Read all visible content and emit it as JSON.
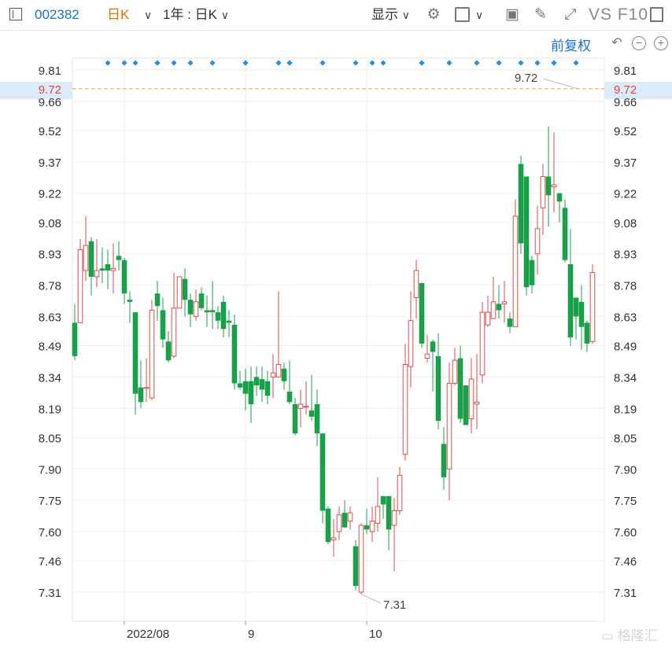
{
  "toolbar": {
    "ticker": "002382",
    "period": "日K",
    "range": "1年 : 日K",
    "display": "显示",
    "vs_f10": "VS F10",
    "icons": [
      "sidebar-toggle-icon",
      "chevron-down-icon",
      "gear-icon",
      "square-icon",
      "camera-icon",
      "pencil-icon",
      "fullscreen-icon"
    ]
  },
  "chart_controls": {
    "adjust": "前复权",
    "icons": [
      "undo-icon",
      "zoom-out-icon",
      "zoom-in-icon"
    ]
  },
  "watermark": "格隆汇",
  "colors": {
    "up": "#e04b4b",
    "down": "#18a148",
    "current": "#e8443a",
    "dashed": "#e0a050",
    "marker": "#1a8fe8",
    "link": "#1a73c8"
  },
  "chart_data": {
    "type": "candlestick",
    "y_ticks": [
      "9.81",
      "9.72",
      "9.66",
      "9.52",
      "9.37",
      "9.22",
      "9.08",
      "8.93",
      "8.78",
      "8.63",
      "8.49",
      "8.34",
      "8.19",
      "8.05",
      "7.90",
      "7.75",
      "7.60",
      "7.46",
      "7.31"
    ],
    "ylim": [
      7.22,
      9.87
    ],
    "current_price": "9.72",
    "max_label": "9.72",
    "min_label": "7.31",
    "x_labels": [
      {
        "label": "2022/08",
        "index": 9
      },
      {
        "label": "9",
        "index": 31
      },
      {
        "label": "10",
        "index": 53
      }
    ],
    "marker_indices": [
      6,
      9,
      11,
      15,
      18,
      21,
      25,
      31,
      37,
      39,
      45,
      51,
      54,
      56,
      63,
      68,
      73,
      77,
      81,
      84,
      87,
      91
    ],
    "candles": [
      [
        8.6,
        8.44,
        8.69,
        8.42
      ],
      [
        8.6,
        8.95,
        9.0,
        8.6
      ],
      [
        8.85,
        8.97,
        9.11,
        8.8
      ],
      [
        8.99,
        8.82,
        9.01,
        8.73
      ],
      [
        8.82,
        8.85,
        9.0,
        8.77
      ],
      [
        8.86,
        8.85,
        8.96,
        8.79
      ],
      [
        8.88,
        8.85,
        8.95,
        8.76
      ],
      [
        8.85,
        8.86,
        8.98,
        8.74
      ],
      [
        8.92,
        8.9,
        8.99,
        8.85
      ],
      [
        8.9,
        8.74,
        8.91,
        8.69
      ],
      [
        8.71,
        8.7,
        8.75,
        8.6
      ],
      [
        8.65,
        8.26,
        8.65,
        8.16
      ],
      [
        8.29,
        8.22,
        8.42,
        8.19
      ],
      [
        8.29,
        8.29,
        8.43,
        8.22
      ],
      [
        8.24,
        8.66,
        8.71,
        8.23
      ],
      [
        8.74,
        8.68,
        8.8,
        8.61
      ],
      [
        8.66,
        8.52,
        8.72,
        8.48
      ],
      [
        8.51,
        8.42,
        8.56,
        8.41
      ],
      [
        8.44,
        8.67,
        8.84,
        8.43
      ],
      [
        8.67,
        8.82,
        8.81,
        8.67
      ],
      [
        8.81,
        8.71,
        8.86,
        8.63
      ],
      [
        8.71,
        8.64,
        8.74,
        8.58
      ],
      [
        8.63,
        8.7,
        8.76,
        8.61
      ],
      [
        8.74,
        8.67,
        8.77,
        8.66
      ],
      [
        8.66,
        8.65,
        8.73,
        8.58
      ],
      [
        8.66,
        8.65,
        8.8,
        8.57
      ],
      [
        8.65,
        8.61,
        8.68,
        8.57
      ],
      [
        8.7,
        8.57,
        8.73,
        8.53
      ],
      [
        8.61,
        8.6,
        8.66,
        8.53
      ],
      [
        8.59,
        8.31,
        8.64,
        8.28
      ],
      [
        8.31,
        8.29,
        8.37,
        8.28
      ],
      [
        8.32,
        8.26,
        8.38,
        8.18
      ],
      [
        8.32,
        8.21,
        8.39,
        8.12
      ],
      [
        8.34,
        8.3,
        8.39,
        8.25
      ],
      [
        8.33,
        8.28,
        8.39,
        8.22
      ],
      [
        8.32,
        8.25,
        8.37,
        8.21
      ],
      [
        8.34,
        8.36,
        8.45,
        8.24
      ],
      [
        8.34,
        8.4,
        8.75,
        8.34
      ],
      [
        8.38,
        8.32,
        8.41,
        8.28
      ],
      [
        8.27,
        8.22,
        8.42,
        8.21
      ],
      [
        8.21,
        8.07,
        8.24,
        8.06
      ],
      [
        8.19,
        8.21,
        8.28,
        8.1
      ],
      [
        8.2,
        8.2,
        8.32,
        8.16
      ],
      [
        8.18,
        8.15,
        8.35,
        8.13
      ],
      [
        8.21,
        8.07,
        8.28,
        8.01
      ],
      [
        8.07,
        7.7,
        8.07,
        7.64
      ],
      [
        7.71,
        7.55,
        7.72,
        7.54
      ],
      [
        7.56,
        7.57,
        7.66,
        7.48
      ],
      [
        7.6,
        7.68,
        7.72,
        7.56
      ],
      [
        7.69,
        7.62,
        7.75,
        7.62
      ],
      [
        7.65,
        7.69,
        7.72,
        7.61
      ],
      [
        7.53,
        7.34,
        7.56,
        7.32
      ],
      [
        7.31,
        7.63,
        7.64,
        7.3
      ],
      [
        7.63,
        7.61,
        7.71,
        7.59
      ],
      [
        7.6,
        7.65,
        7.72,
        7.55
      ],
      [
        7.64,
        7.72,
        7.86,
        7.6
      ],
      [
        7.77,
        7.73,
        7.76,
        7.66
      ],
      [
        7.77,
        7.61,
        7.77,
        7.51
      ],
      [
        7.63,
        7.7,
        7.76,
        7.41
      ],
      [
        7.7,
        7.87,
        7.91,
        7.68
      ],
      [
        7.97,
        8.4,
        8.5,
        7.94
      ],
      [
        8.39,
        8.61,
        8.75,
        8.29
      ],
      [
        8.72,
        8.85,
        8.9,
        8.62
      ],
      [
        8.79,
        8.5,
        8.79,
        8.48
      ],
      [
        8.43,
        8.45,
        8.54,
        8.41
      ],
      [
        8.51,
        8.46,
        8.52,
        8.27
      ],
      [
        8.44,
        8.13,
        8.55,
        8.09
      ],
      [
        8.02,
        7.86,
        8.1,
        7.8
      ],
      [
        7.9,
        8.31,
        8.41,
        7.75
      ],
      [
        8.31,
        8.42,
        8.48,
        8.3
      ],
      [
        8.43,
        8.14,
        8.49,
        8.12
      ],
      [
        8.3,
        8.11,
        8.3,
        8.11
      ],
      [
        8.14,
        8.33,
        8.43,
        8.07
      ],
      [
        8.21,
        8.22,
        8.45,
        8.09
      ],
      [
        8.35,
        8.65,
        8.7,
        8.31
      ],
      [
        8.59,
        8.65,
        8.73,
        8.58
      ],
      [
        8.62,
        8.7,
        8.82,
        8.62
      ],
      [
        8.69,
        8.66,
        8.78,
        8.62
      ],
      [
        8.69,
        8.7,
        8.8,
        8.6
      ],
      [
        8.62,
        8.58,
        8.65,
        8.55
      ],
      [
        8.58,
        9.11,
        9.19,
        8.58
      ],
      [
        9.36,
        8.98,
        9.4,
        8.93
      ],
      [
        9.3,
        8.77,
        9.3,
        8.73
      ],
      [
        8.9,
        8.78,
        8.92,
        8.74
      ],
      [
        8.93,
        9.05,
        9.16,
        8.83
      ],
      [
        9.15,
        9.3,
        9.36,
        9.02
      ],
      [
        9.3,
        9.21,
        9.54,
        9.06
      ],
      [
        9.25,
        9.26,
        9.51,
        9.13
      ],
      [
        9.22,
        9.18,
        9.22,
        9.08
      ],
      [
        9.15,
        8.9,
        9.19,
        8.89
      ],
      [
        8.88,
        8.53,
        9.05,
        8.49
      ],
      [
        8.72,
        8.63,
        8.7,
        8.52
      ],
      [
        8.7,
        8.58,
        8.78,
        8.47
      ],
      [
        8.6,
        8.5,
        8.61,
        8.46
      ],
      [
        8.51,
        8.84,
        8.88,
        8.5
      ]
    ]
  }
}
